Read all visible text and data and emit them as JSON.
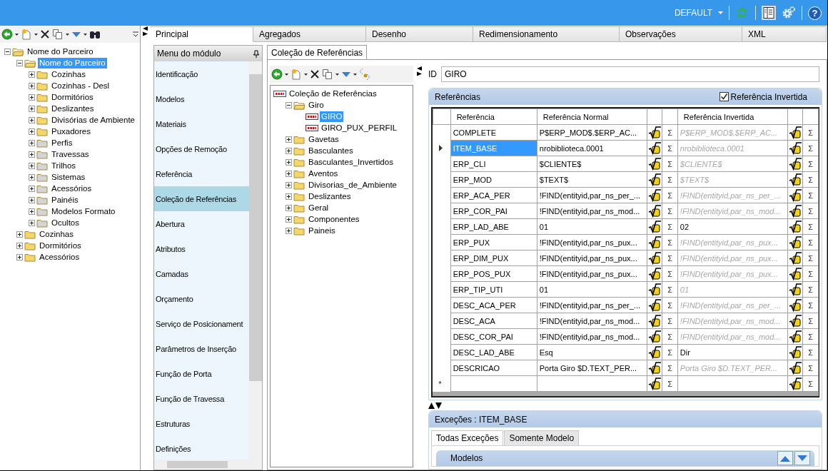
{
  "topbar": {
    "profile": "DEFAULT",
    "help": "?"
  },
  "explorer": {
    "tree": [
      {
        "label": "Nome do Parceiro",
        "color": "#f6d66a",
        "expanded": true,
        "selected": false,
        "children": [
          {
            "label": "Nome do Parceiro",
            "color": "#f6d66a",
            "expanded": true,
            "selected": true,
            "children": [
              {
                "label": "Cozinhas",
                "color": "#f6d66a",
                "expanded": false,
                "selected": false
              },
              {
                "label": "Cozinhas - Desl",
                "color": "#f6d66a",
                "expanded": false,
                "selected": false
              },
              {
                "label": "Dormitórios",
                "color": "#f6d66a",
                "expanded": false,
                "selected": false
              },
              {
                "label": "Deslizantes",
                "color": "#f6d66a",
                "expanded": false,
                "selected": false
              },
              {
                "label": "Divisórias de Ambiente",
                "color": "#f6d66a",
                "expanded": false,
                "selected": false
              },
              {
                "label": "Puxadores",
                "color": "#f6d66a",
                "expanded": false,
                "selected": false
              },
              {
                "label": "Perfis",
                "color": "#d4d4d4",
                "expanded": false,
                "selected": false
              },
              {
                "label": "Travessas",
                "color": "#d4d4d4",
                "expanded": false,
                "selected": false
              },
              {
                "label": "Trilhos",
                "color": "#d4d4d4",
                "expanded": false,
                "selected": false
              },
              {
                "label": "Sistemas",
                "color": "#d4d4d4",
                "expanded": false,
                "selected": false
              },
              {
                "label": "Acessórios",
                "color": "#d4d4d4",
                "expanded": false,
                "selected": false
              },
              {
                "label": "Painéis",
                "color": "#d4d4d4",
                "expanded": false,
                "selected": false
              },
              {
                "label": "Modelos Formato",
                "color": "#d4d4d4",
                "expanded": false,
                "selected": false
              },
              {
                "label": "Ocultos",
                "color": "#d4d4d4",
                "expanded": false,
                "selected": false
              }
            ]
          },
          {
            "label": "Cozinhas",
            "color": "#f6d66a",
            "expanded": false,
            "selected": false
          },
          {
            "label": "Dormitórios",
            "color": "#f6d66a",
            "expanded": false,
            "selected": false
          },
          {
            "label": "Acessórios",
            "color": "#f6d66a",
            "expanded": false,
            "selected": false
          }
        ]
      }
    ]
  },
  "tabs": [
    {
      "label": "Principal",
      "selected": true
    },
    {
      "label": "Agregados",
      "selected": false
    },
    {
      "label": "Desenho",
      "selected": false
    },
    {
      "label": "Redimensionamento",
      "selected": false
    },
    {
      "label": "Observações",
      "selected": false
    },
    {
      "label": "XML",
      "selected": false
    }
  ],
  "module_menu": {
    "title": "Menu do módulo",
    "items": [
      {
        "label": "Identificação",
        "selected": false
      },
      {
        "label": "Modelos",
        "selected": false
      },
      {
        "label": "Materiais",
        "selected": false
      },
      {
        "label": "Opções de Remoção",
        "selected": false
      },
      {
        "label": "Referência",
        "selected": false
      },
      {
        "label": "Coleção de Referências",
        "selected": true
      },
      {
        "label": "Abertura",
        "selected": false
      },
      {
        "label": "Atributos",
        "selected": false
      },
      {
        "label": "Camadas",
        "selected": false
      },
      {
        "label": "Orçamento",
        "selected": false
      },
      {
        "label": "Serviço de Posicionament",
        "selected": false
      },
      {
        "label": "Parâmetros de Inserção",
        "selected": false
      },
      {
        "label": "Função de Porta",
        "selected": false
      },
      {
        "label": "Função de Travessa",
        "selected": false
      },
      {
        "label": "Estruturas",
        "selected": false
      },
      {
        "label": "Definições",
        "selected": false
      }
    ]
  },
  "inner_tabs": [
    {
      "label": "Coleção de Referências",
      "selected": true
    }
  ],
  "collection_tree": [
    {
      "kind": "collection",
      "label": "Coleção de Referências",
      "selected": false,
      "children": [
        {
          "kind": "folder",
          "label": "Giro",
          "expanded": true,
          "selected": false,
          "children": [
            {
              "kind": "code",
              "label": "GIRO",
              "selected": true
            },
            {
              "kind": "code",
              "label": "GIRO_PUX_PERFIL",
              "selected": false
            }
          ]
        },
        {
          "kind": "folder",
          "label": "Gavetas",
          "expanded": false,
          "selected": false
        },
        {
          "kind": "folder",
          "label": "Basculantes",
          "expanded": false,
          "selected": false
        },
        {
          "kind": "folder",
          "label": "Basculantes_Invertidos",
          "expanded": false,
          "selected": false
        },
        {
          "kind": "folder",
          "label": "Aventos",
          "expanded": false,
          "selected": false
        },
        {
          "kind": "folder",
          "label": "Divisorias_de_Ambiente",
          "expanded": false,
          "selected": false
        },
        {
          "kind": "folder",
          "label": "Deslizantes",
          "expanded": false,
          "selected": false
        },
        {
          "kind": "folder",
          "label": "Geral",
          "expanded": false,
          "selected": false
        },
        {
          "kind": "folder",
          "label": "Componentes",
          "expanded": false,
          "selected": false
        },
        {
          "kind": "folder",
          "label": "Paineis",
          "expanded": false,
          "selected": false
        }
      ]
    }
  ],
  "id_field": {
    "label": "ID",
    "value": "GIRO"
  },
  "references": {
    "title": "Referências",
    "inverted_checkbox": {
      "label": "Referência Invertida",
      "checked": true
    },
    "columns": [
      "Referência",
      "Referência Normal",
      "Referência Invertida"
    ],
    "rows": [
      {
        "name": "COMPLETE",
        "normal": "P$ERP_MOD$.$ERP_AC...",
        "inverted": "P$ERP_MOD$.$ERP_AC...",
        "inverted_inherited": true,
        "selected": false,
        "normal_sum": "Σ",
        "inverted_sum": "Σ"
      },
      {
        "name": "ITEM_BASE",
        "normal": "nrobiblioteca.0001",
        "inverted": "nrobiblioteca.0001",
        "inverted_inherited": true,
        "selected": true,
        "normal_sum": "Σ",
        "inverted_sum": "Σ"
      },
      {
        "name": "ERP_CLI",
        "normal": "$CLIENTE$",
        "inverted": "$CLIENTE$",
        "inverted_inherited": true,
        "selected": false,
        "normal_sum": "Σ",
        "inverted_sum": "Σ"
      },
      {
        "name": "ERP_MOD",
        "normal": "$TEXT$",
        "inverted": "$TEXT$",
        "inverted_inherited": true,
        "selected": false,
        "normal_sum": "Σ",
        "inverted_sum": "Σ"
      },
      {
        "name": "ERP_ACA_PER",
        "normal": "!FIND(entityid,par_ns_per_...",
        "inverted": "!FIND(entityid,par_ns_per_...",
        "inverted_inherited": true,
        "selected": false,
        "normal_sum": "Σ",
        "inverted_sum": "Σ"
      },
      {
        "name": "ERP_COR_PAI",
        "normal": "!FIND(entityid,par_ns_mod...",
        "inverted": "!FIND(entityid,par_ns_mod...",
        "inverted_inherited": true,
        "selected": false,
        "normal_sum": "Σ",
        "inverted_sum": "Σ"
      },
      {
        "name": "ERP_LAD_ABE",
        "normal": "01",
        "inverted": "02",
        "inverted_inherited": false,
        "selected": false,
        "normal_sum": "Σ",
        "inverted_sum": "Σ"
      },
      {
        "name": "ERP_PUX",
        "normal": "!FIND(entityid,par_ns_pux...",
        "inverted": "!FIND(entityid,par_ns_pux...",
        "inverted_inherited": true,
        "selected": false,
        "normal_sum": "Σ",
        "inverted_sum": "Σ"
      },
      {
        "name": "ERP_DIM_PUX",
        "normal": "!FIND(entityid,par_ns_pux...",
        "inverted": "!FIND(entityid,par_ns_pux...",
        "inverted_inherited": true,
        "selected": false,
        "normal_sum": "Σ",
        "inverted_sum": "Σ"
      },
      {
        "name": "ERP_POS_PUX",
        "normal": "!FIND(entityid,par_ns_pux...",
        "inverted": "!FIND(entityid,par_ns_pux...",
        "inverted_inherited": true,
        "selected": false,
        "normal_sum": "Σ",
        "inverted_sum": "Σ"
      },
      {
        "name": "ERP_TIP_UTI",
        "normal": "01",
        "inverted": "01",
        "inverted_inherited": true,
        "selected": false,
        "normal_sum": "Σ",
        "inverted_sum": "Σ"
      },
      {
        "name": "DESC_ACA_PER",
        "normal": "!FIND(entityid,par_ns_per_...",
        "inverted": "!FIND(entityid,par_ns_per_...",
        "inverted_inherited": true,
        "selected": false,
        "normal_sum": "Σ",
        "inverted_sum": "Σ"
      },
      {
        "name": "DESC_ACA",
        "normal": "!FIND(entityid,par_ns_mod...",
        "inverted": "!FIND(entityid,par_ns_mod...",
        "inverted_inherited": true,
        "selected": false,
        "normal_sum": "Σ",
        "inverted_sum": "Σ"
      },
      {
        "name": "DESC_COR_PAI",
        "normal": "!FIND(entityid,par_ns_mod...",
        "inverted": "!FIND(entityid,par_ns_mod...",
        "inverted_inherited": true,
        "selected": false,
        "normal_sum": "Σ",
        "inverted_sum": "Σ"
      },
      {
        "name": "DESC_LAD_ABE",
        "normal": "Esq",
        "inverted": "Dir",
        "inverted_inherited": false,
        "selected": false,
        "normal_sum": "Σ",
        "inverted_sum": "Σ"
      },
      {
        "name": "DESCRICAO",
        "normal": "Porta Giro $D.TEXT_PER...",
        "inverted": "Porta Giro $D.TEXT_PER...",
        "inverted_inherited": true,
        "selected": false,
        "normal_sum": "Σ",
        "inverted_sum": "Σ"
      }
    ],
    "new_row": {
      "marker": "*",
      "normal_sum": "Σ",
      "inverted_sum": "Σ"
    }
  },
  "exceptions": {
    "title": "Exceções : ITEM_BASE",
    "tabs": [
      {
        "label": "Todas Exceções",
        "selected": true
      },
      {
        "label": "Somente Modelo",
        "selected": false
      }
    ],
    "section": "Modelos"
  }
}
